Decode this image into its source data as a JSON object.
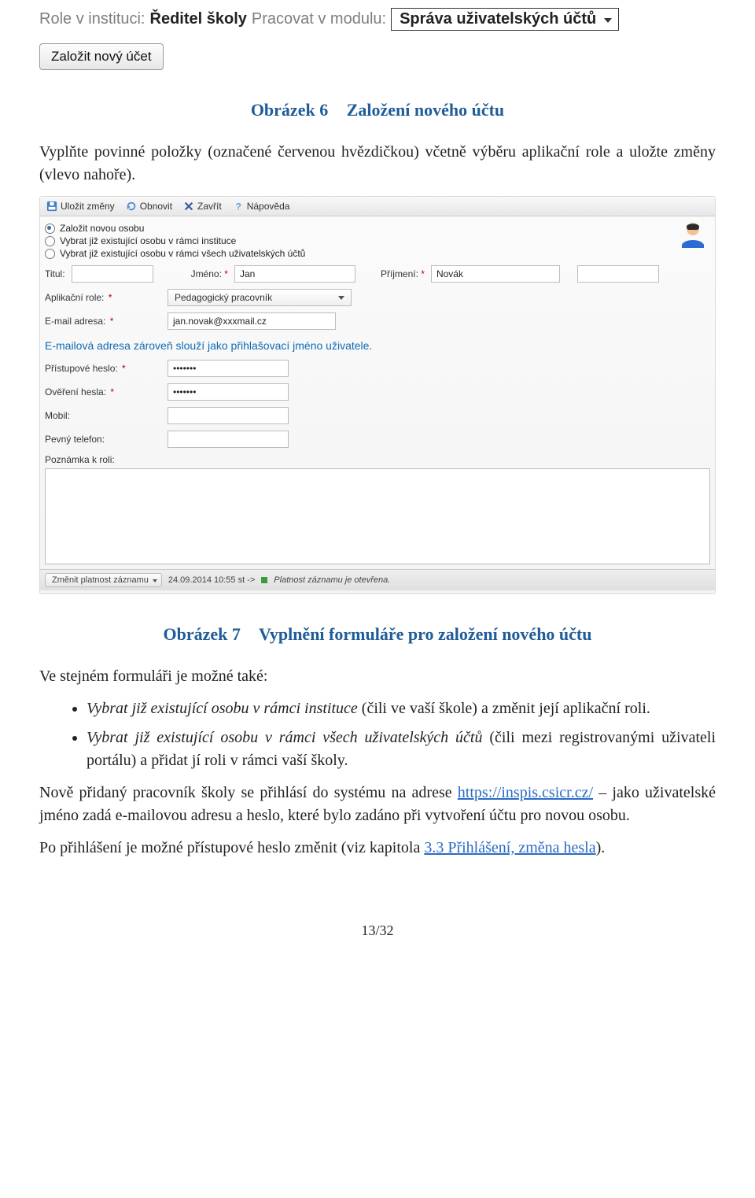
{
  "topbar": {
    "role_label": "Role v instituci:",
    "role_value": "Ředitel školy",
    "module_label": "Pracovat v modulu:",
    "module_value": "Správa uživatelských účtů"
  },
  "btn_create": "Založit nový účet",
  "caption1_num": "Obrázek 6",
  "caption1_title": "Založení nového účtu",
  "para1": "Vyplňte povinné položky (označené červenou hvězdičkou) včetně výběru aplikační role a uložte změny (vlevo nahoře).",
  "form": {
    "toolbar": {
      "save": "Uložit změny",
      "refresh": "Obnovit",
      "close": "Zavřít",
      "help": "Nápověda"
    },
    "radios": {
      "r1": "Založit novou osobu",
      "r2": "Vybrat již existující osobu v rámci instituce",
      "r3": "Vybrat již existující osobu v rámci všech uživatelských účtů"
    },
    "labels": {
      "titul": "Titul:",
      "jmeno": "Jméno:",
      "prijmeni": "Příjmení:",
      "role": "Aplikační role:",
      "email": "E-mail adresa:",
      "heslo": "Přístupové heslo:",
      "overeni": "Ověření hesla:",
      "mobil": "Mobil:",
      "tel": "Pevný telefon:",
      "pozn": "Poznámka k roli:"
    },
    "values": {
      "jmeno": "Jan",
      "prijmeni": "Novák",
      "role": "Pedagogický pracovník",
      "email": "jan.novak@xxxmail.cz",
      "heslo": "•••••••",
      "overeni": "•••••••"
    },
    "hint": "E-mailová adresa zároveň slouží jako přihlašovací jméno uživatele.",
    "status": {
      "btn": "Změnit platnost záznamu",
      "ts": "24.09.2014 10:55 st ->",
      "msg": "Platnost záznamu je otevřena."
    }
  },
  "caption2_num": "Obrázek 7",
  "caption2_title": "Vyplnění formuláře pro založení nového účtu",
  "para2": "Ve stejném formuláři je možné také:",
  "bullets": {
    "b1a": "Vybrat již existující osobu v rámci instituce",
    "b1b": " (čili ve vaší škole) a změnit její aplikační roli.",
    "b2a": "Vybrat již existující osobu v rámci všech uživatelských účtů",
    "b2b": " (čili mezi registrovanými uživateli portálu) a přidat jí roli v rámci vaší školy."
  },
  "para3a": "Nově přidaný pracovník školy se přihlásí do systému na adrese ",
  "para3link": "https://inspis.csicr.cz/",
  "para3b": " – jako uživatelské jméno zadá e-mailovou adresu a heslo, které bylo zadáno při vytvoření účtu pro novou osobu.",
  "para4a": "Po přihlášení je možné přístupové heslo změnit (viz kapitola ",
  "para4link": "3.3 Přihlášení, změna hesla",
  "para4b": ").",
  "pagenum": "13/32"
}
